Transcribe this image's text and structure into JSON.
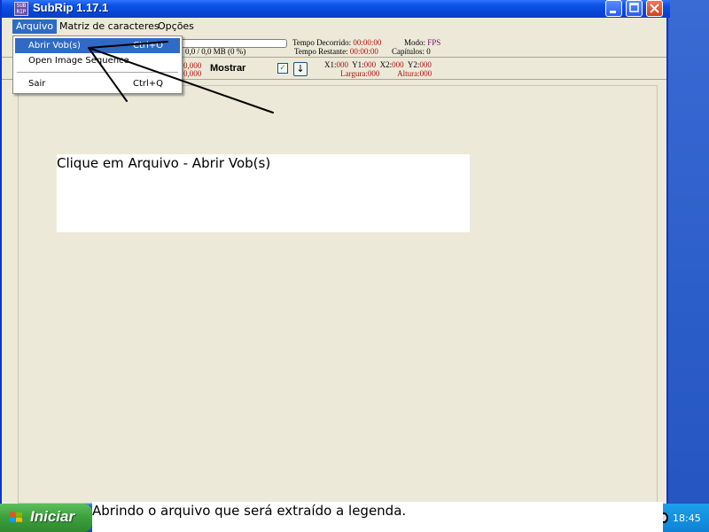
{
  "window": {
    "title": "SubRip 1.17.1",
    "icon_text": "SUB RIP"
  },
  "menubar": {
    "items": [
      "Arquivo",
      "Matriz de caracteres",
      "Opções"
    ]
  },
  "dropdown": {
    "items": [
      {
        "label": "Abrir Vob(s)",
        "shortcut": "Ctrl+O"
      },
      {
        "label": "Open Image Sequence",
        "shortcut": ""
      },
      {
        "label": "Sair",
        "shortcut": "Ctrl+Q"
      }
    ]
  },
  "status": {
    "progress_text": "0,0 / 0,0 MB (0 %)",
    "tempo_decorrido_label": "Tempo Decorrido:",
    "tempo_decorrido": "00:00:00",
    "tempo_restante_label": "Tempo Restante:",
    "tempo_restante": "00:00:00",
    "modo_label": "Modo:",
    "modo": "FPS",
    "capitulos_label": "Capítulos:",
    "capitulos": "0",
    "num1": "0,000",
    "num2": "0,000",
    "mostrar": "Mostrar",
    "checkbox_glyph": "✓",
    "down_glyph": "↓",
    "x1_label": "X1:",
    "x1": "000",
    "y1_label": "Y1:",
    "y1": "000",
    "x2_label": "X2:",
    "x2": "000",
    "y2_label": "Y2:",
    "y2": "000",
    "largura_label": "Largura:",
    "largura": "000",
    "altura_label": "Altura:",
    "altura": "000"
  },
  "annotation": {
    "note": "Clique em Arquivo - Abrir Vob(s)",
    "caption": "Abrindo o arquivo que será extraído a legenda."
  },
  "taskbar": {
    "start_label": "Iniciar",
    "clock": "18:45"
  },
  "colors": {
    "titlebar": "#0746d8",
    "menu_highlight": "#316ac5",
    "value_red": "#b01010",
    "value_purple": "#7a0d6a",
    "start_green": "#3c9e3c"
  }
}
